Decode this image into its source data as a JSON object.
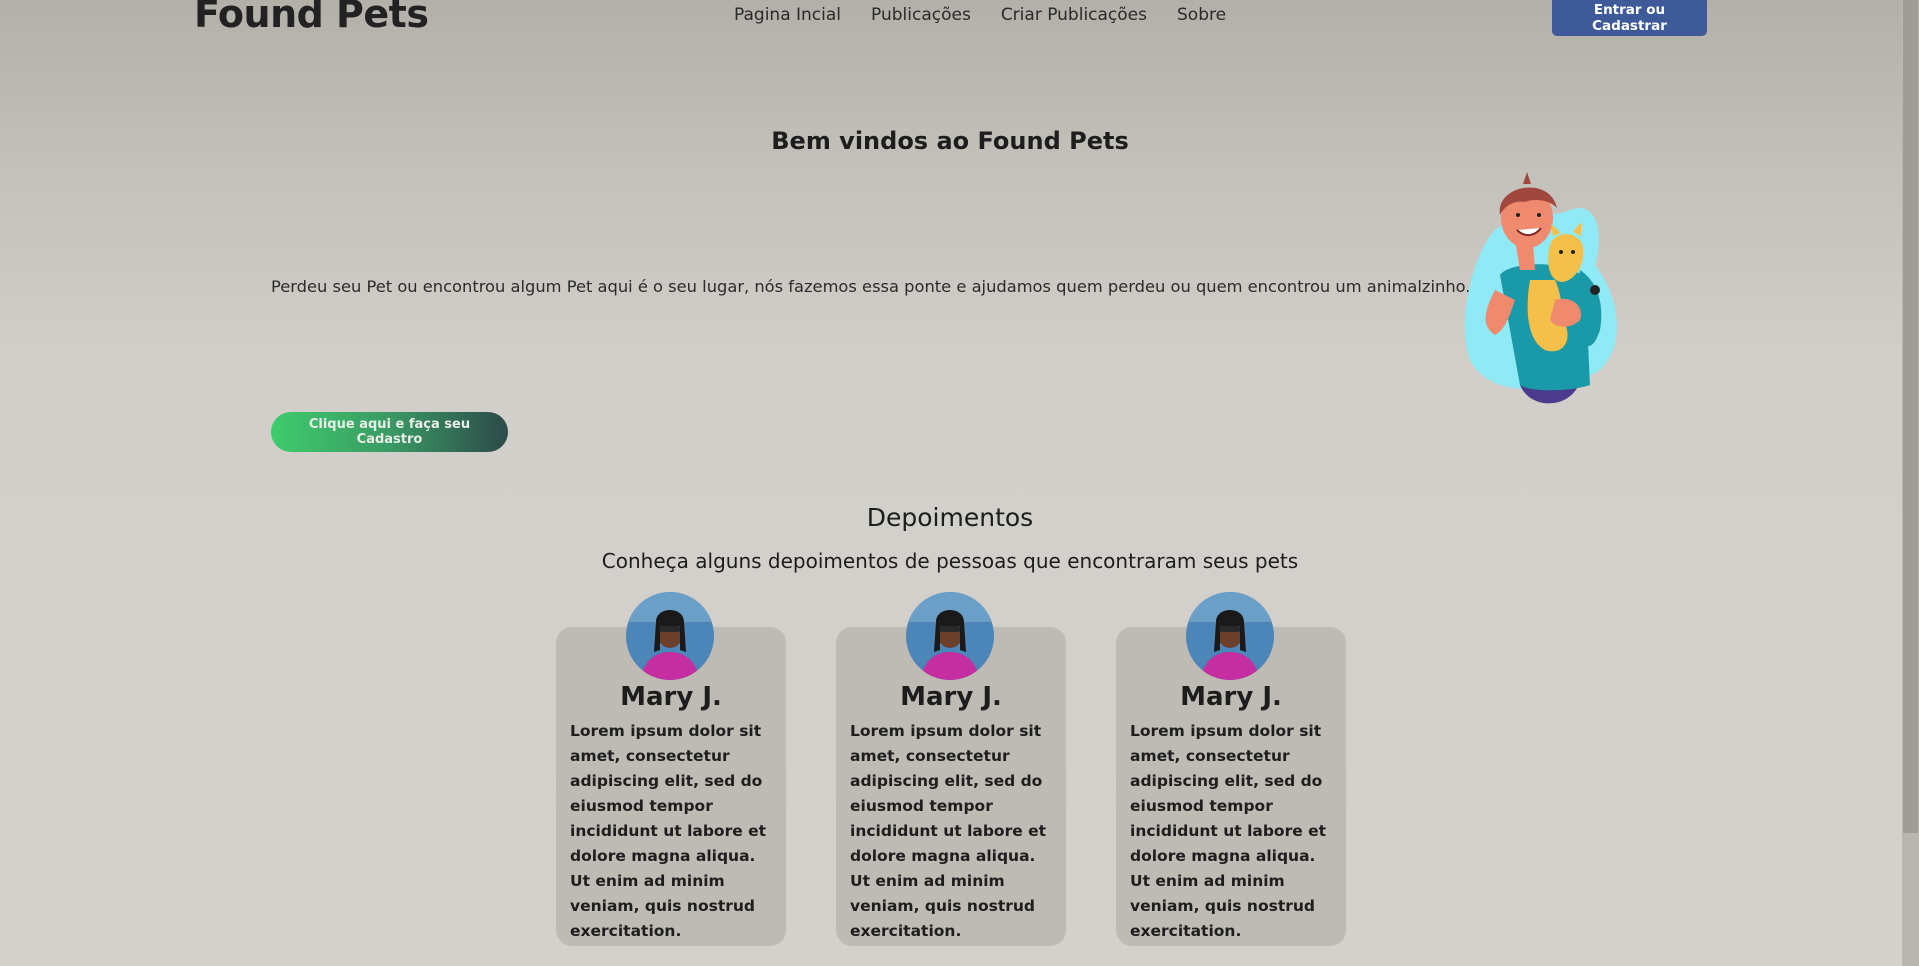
{
  "header": {
    "logo": "Found Pets",
    "nav": [
      "Pagina Incial",
      "Publicações",
      "Criar Publicações",
      "Sobre"
    ],
    "login_button": "Entrar ou Cadastrar"
  },
  "hero": {
    "title": "Bem vindos ao Found Pets",
    "text": "Perdeu seu Pet ou encontrou algum Pet aqui é o seu lugar, nós fazemos essa ponte e ajudamos quem perdeu ou quem encontrou um animalzinho.",
    "cta_button": "Clique aqui e faça seu Cadastro",
    "illustration": "boy-holding-cat-illustration"
  },
  "testimonials": {
    "title": "Depoimentos",
    "subtitle": "Conheça alguns depoimentos de pessoas que encontraram seus pets",
    "cards": [
      {
        "name": "Mary J.",
        "text": "Lorem ipsum dolor sit amet, consectetur adipiscing elit, sed do eiusmod tempor incididunt ut labore et dolore magna aliqua. Ut enim ad minim veniam, quis nostrud exercitation."
      },
      {
        "name": "Mary J.",
        "text": "Lorem ipsum dolor sit amet, consectetur adipiscing elit, sed do eiusmod tempor incididunt ut labore et dolore magna aliqua. Ut enim ad minim veniam, quis nostrud exercitation."
      },
      {
        "name": "Mary J.",
        "text": "Lorem ipsum dolor sit amet, consectetur adipiscing elit, sed do eiusmod tempor incididunt ut labore et dolore magna aliqua. Ut enim ad minim veniam, quis nostrud exercitation."
      }
    ]
  },
  "colors": {
    "login_button": "#3e5a98",
    "cta_gradient_start": "#3fcc6c",
    "cta_gradient_end": "#2d4a4a",
    "card_background": "#bebbb4"
  }
}
